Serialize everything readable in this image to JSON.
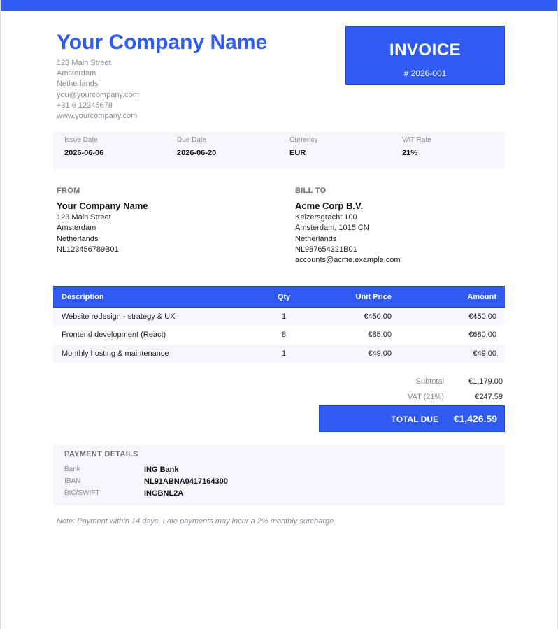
{
  "company": {
    "name": "Your Company Name",
    "address_lines": [
      "123 Main Street",
      "Amsterdam",
      "Netherlands",
      "you@yourcompany.com",
      "+31 6 12345678",
      "www.yourcompany.com"
    ]
  },
  "invoice": {
    "title": "INVOICE",
    "number": "# 2026-001"
  },
  "meta": [
    {
      "label": "Issue Date",
      "value": "2026-06-06"
    },
    {
      "label": "Due Date",
      "value": "2026-06-20"
    },
    {
      "label": "Currency",
      "value": "EUR"
    },
    {
      "label": "VAT Rate",
      "value": "21%"
    }
  ],
  "from": {
    "heading": "FROM",
    "name": "Your Company Name",
    "lines": [
      "123 Main Street",
      "Amsterdam",
      "Netherlands",
      "NL123456789B01"
    ]
  },
  "bill_to": {
    "heading": "BILL TO",
    "name": "Acme Corp B.V.",
    "lines": [
      "Keizersgracht 100",
      "Amsterdam, 1015 CN",
      "Netherlands",
      "NL987654321B01",
      "accounts@acme.example.com"
    ]
  },
  "items": {
    "headers": [
      "Description",
      "Qty",
      "Unit Price",
      "Amount"
    ],
    "rows": [
      [
        "Website redesign - strategy & UX",
        "1",
        "€450.00",
        "€450.00"
      ],
      [
        "Frontend development (React)",
        "8",
        "€85.00",
        "€680.00"
      ],
      [
        "Monthly hosting & maintenance",
        "1",
        "€49.00",
        "€49.00"
      ]
    ]
  },
  "totals": {
    "subtotal_label": "Subtotal",
    "subtotal_value": "€1,179.00",
    "vat_label": "VAT (21%)",
    "vat_value": "€247.59",
    "total_label": "TOTAL DUE",
    "total_value": "€1,426.59"
  },
  "payment": {
    "heading": "PAYMENT DETAILS",
    "rows": [
      {
        "label": "Bank",
        "value": "ING Bank"
      },
      {
        "label": "IBAN",
        "value": "NL91ABNA0417164300"
      },
      {
        "label": "BIC/SWIFT",
        "value": "INGBNL2A"
      }
    ]
  },
  "note": "Note: Payment within 14 days. Late payments may incur a 2% monthly surcharge.",
  "colors": {
    "accent": "#2f5bf2",
    "panel": "#f6f6fc",
    "muted_text": "#888892"
  }
}
